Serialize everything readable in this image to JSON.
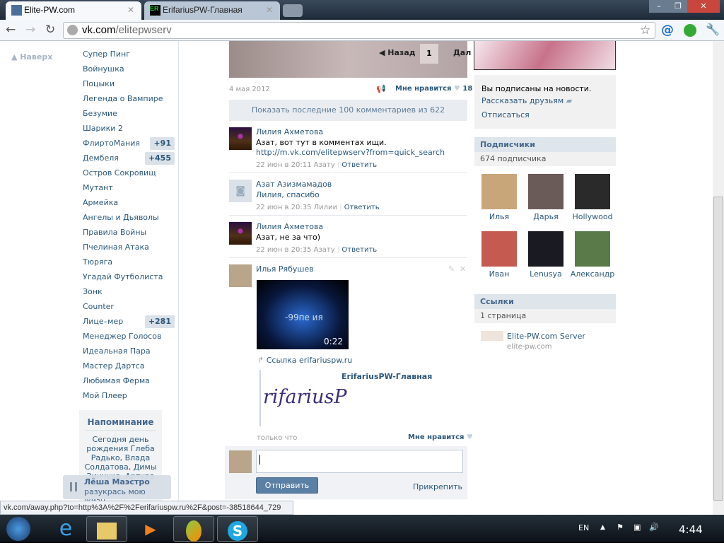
{
  "browser": {
    "tabs": [
      {
        "title": "Elite-PW.com",
        "icon": "vk-icon"
      },
      {
        "title": "ErifariusPW-Главная",
        "icon": "ER"
      }
    ],
    "url_host": "vk.com",
    "url_path": "/elitepwserv"
  },
  "left": {
    "to_top": "Наверх",
    "menu": [
      {
        "label": "Супер Пинг"
      },
      {
        "label": "Войнушка"
      },
      {
        "label": "Поцыки"
      },
      {
        "label": "Легенда о Вампире"
      },
      {
        "label": "Безумие"
      },
      {
        "label": "Шарики 2"
      },
      {
        "label": "ФлиртоМания",
        "badge": "+91"
      },
      {
        "label": "Дембеля",
        "badge": "+455"
      },
      {
        "label": "Остров Сокровищ"
      },
      {
        "label": "Мутант"
      },
      {
        "label": "Армейка"
      },
      {
        "label": "Ангелы и Дьяволы"
      },
      {
        "label": "Правила Войны"
      },
      {
        "label": "Пчелиная Атака"
      },
      {
        "label": "Тюряга"
      },
      {
        "label": "Угадай Футболиста"
      },
      {
        "label": "Зонк"
      },
      {
        "label": "Counter"
      },
      {
        "label": "Лице–мер",
        "badge": "+281"
      },
      {
        "label": "Менеджер Голосов"
      },
      {
        "label": "Идеальная Пара"
      },
      {
        "label": "Мастер Дартса"
      },
      {
        "label": "Любимая Ферма"
      },
      {
        "label": "Мой Плеер"
      }
    ],
    "reminder": {
      "title": "Напоминание",
      "text": "Сегодня день рождения Глеба Радько, Влада Солдатова, Димы Зинчука, Артура"
    },
    "player": {
      "artist": "Лёша Маэстро",
      "song": "разукрась мою жизн..."
    }
  },
  "post": {
    "nav_back": "Назад",
    "page": "1",
    "nav_next": "Дал",
    "date": "4 мая 2012",
    "like_label": "Мне нравится",
    "like_count": "18",
    "show_comments": "Показать последние 100 комментариев из 622"
  },
  "comments": [
    {
      "author": "Лилия Ахметова",
      "text": "Азат, вот тут в комментах ищи.",
      "link": "http://m.vk.com/elitepwserv?from=quick_search",
      "time": "22 июн в 20:11",
      "to": "Азату",
      "reply": "Ответить"
    },
    {
      "author": "Азат Азизмамадов",
      "text": "Лилия, спасибо",
      "time": "22 июн в 20:35",
      "to": "Лилии",
      "reply": "Ответить"
    },
    {
      "author": "Лилия Ахметова",
      "text": "Азат, не за что)",
      "time": "22 июн в 20:35",
      "to": "Азату",
      "reply": "Ответить"
    },
    {
      "author": "Илья Рябушев",
      "video_title": "-99пе ия",
      "video_duration": "0:22",
      "link_label": "Ссылка erifariuspw.ru",
      "snippet_title": "ErifariusPW-Главная",
      "snippet_image_text": "rifariusP",
      "time": "только что",
      "like_label": "Мне нравится"
    }
  ],
  "reply_form": {
    "send": "Отправить",
    "attach": "Прикрепить"
  },
  "right": {
    "subscribed": "Вы подписаны на новости.",
    "tell_friends": "Рассказать друзьям",
    "unsubscribe": "Отписаться",
    "subs_title": "Подписчики",
    "subs_count": "674 подписчика",
    "subs": [
      "Илья",
      "Дарья",
      "Hollywood",
      "Иван",
      "Lenusya",
      "Александр"
    ],
    "links_title": "Ссылки",
    "links_count": "1 страница",
    "link_name": "Elite-PW.com Server",
    "link_domain": "elite-pw.com"
  },
  "status_url": "vk.com/away.php?to=http%3A%2F%2Ferifariuspw.ru%2F&post=-38518644_729",
  "taskbar": {
    "lang": "EN",
    "clock": "4:44"
  }
}
